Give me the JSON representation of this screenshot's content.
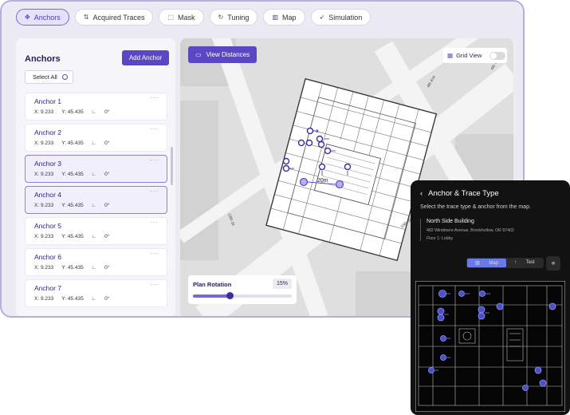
{
  "tabs": [
    {
      "label": "Anchors",
      "icon": "anchor-icon",
      "active": true
    },
    {
      "label": "Acquired Traces",
      "icon": "traces-icon",
      "active": false
    },
    {
      "label": "Mask",
      "icon": "mask-icon",
      "active": false
    },
    {
      "label": "Tuning",
      "icon": "tuning-icon",
      "active": false
    },
    {
      "label": "Map",
      "icon": "map-icon",
      "active": false
    },
    {
      "label": "Simulation",
      "icon": "simulation-icon",
      "active": false
    }
  ],
  "panel": {
    "title": "Anchors",
    "add_label": "Add Anchor",
    "select_all_label": "Select All",
    "items": [
      {
        "name": "Anchor 1",
        "x": "X: 9.233",
        "y": "Y: 45.435",
        "angle": "0°",
        "more": "···"
      },
      {
        "name": "Anchor 2",
        "x": "X: 9.233",
        "y": "Y: 45.435",
        "angle": "0°",
        "more": "···"
      },
      {
        "name": "Anchor 3",
        "x": "X: 9.233",
        "y": "Y: 45.435",
        "angle": "0°",
        "more": "···"
      },
      {
        "name": "Anchor 4",
        "x": "X: 9.233",
        "y": "Y: 45.435",
        "angle": "0°",
        "more": "···"
      },
      {
        "name": "Anchor 5",
        "x": "X: 9.233",
        "y": "Y: 45.435",
        "angle": "0°",
        "more": "···"
      },
      {
        "name": "Anchor 6",
        "x": "X: 9.233",
        "y": "Y: 45.435",
        "angle": "0°",
        "more": "···"
      },
      {
        "name": "Anchor 7",
        "x": "X: 9.233",
        "y": "Y: 45.435",
        "angle": "0°",
        "more": "···"
      }
    ]
  },
  "map": {
    "view_distances_label": "View Distances",
    "grid_view_label": "Grid View",
    "grid_view_on": false,
    "distance_label": "20m",
    "street_labels": [
      "18th St",
      "19th St",
      "4th Ave",
      "4th St"
    ],
    "rotation": {
      "label": "Plan Rotation",
      "value_text": "15%",
      "value": 0.37
    }
  },
  "mobile": {
    "title": "Anchor & Trace Type",
    "subtitle": "Select the trace type & anchor from the map.",
    "building": "North Side Building",
    "address": "482 Windmere Avenue, Brookhollow, OR 97402",
    "floor": "Floor 1: Lobby",
    "seg_map": "Map",
    "seg_test": "Test"
  },
  "colors": {
    "accent": "#5b47c4",
    "accent_light": "#e7e2fb",
    "mobile_accent": "#6a79e8"
  }
}
